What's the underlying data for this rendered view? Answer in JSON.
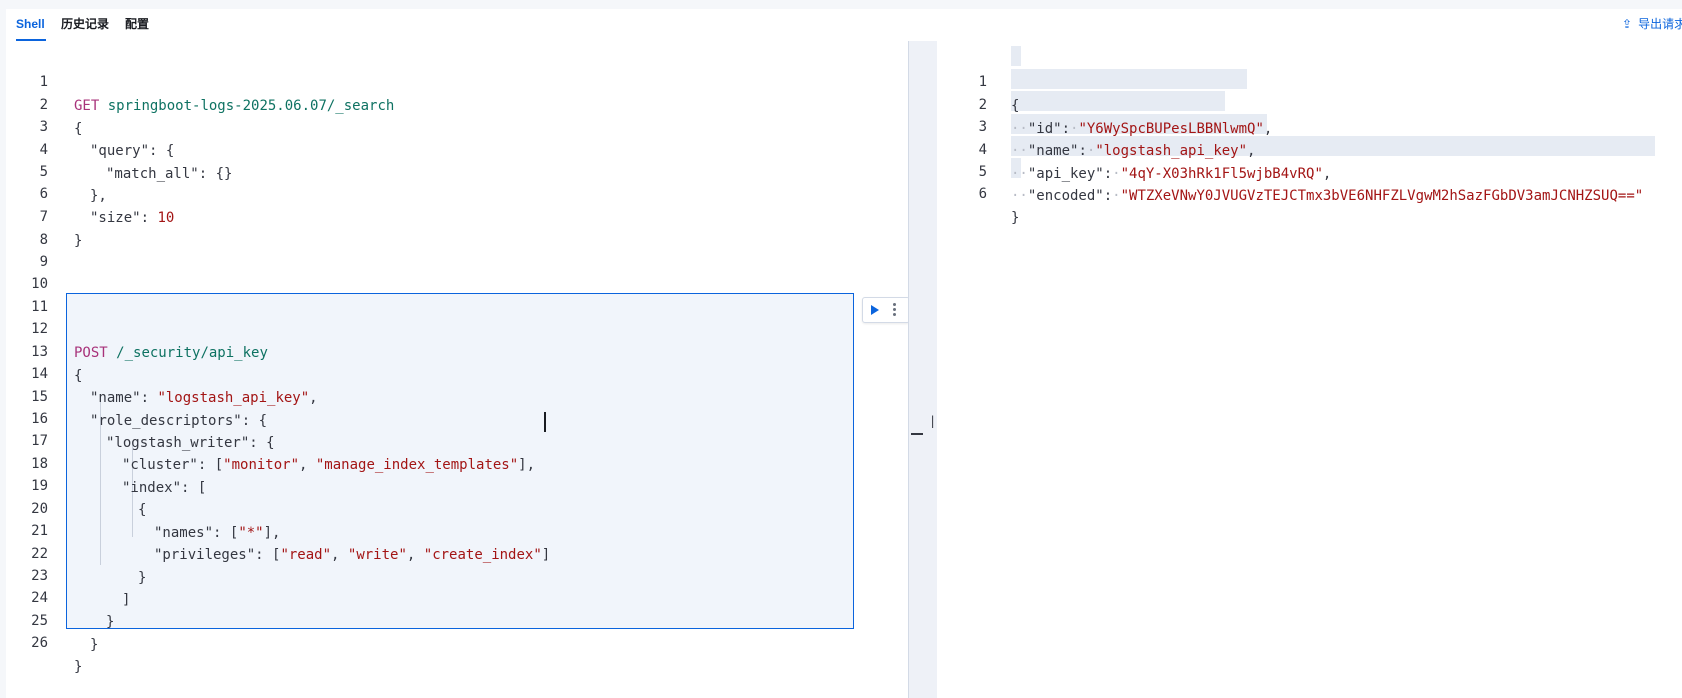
{
  "tabs": [
    {
      "label": "Shell",
      "active": true
    },
    {
      "label": "历史记录",
      "active": false
    },
    {
      "label": "配置",
      "active": false
    }
  ],
  "export_label": "导出请求",
  "icons": {
    "export": "upload-icon",
    "run": "play-icon",
    "more": "kebab-menu-icon",
    "divider": "resize-handle-icon"
  },
  "colors": {
    "accent": "#0b64dd",
    "method": "#a8327a",
    "url": "#0e7262",
    "string": "#a31515"
  },
  "editor": {
    "line_numbers": [
      "1",
      "2",
      "3",
      "4",
      "5",
      "6",
      "7",
      "8",
      "9",
      "10",
      "11",
      "12",
      "13",
      "14",
      "15",
      "16",
      "17",
      "18",
      "19",
      "20",
      "21",
      "22",
      "23",
      "24",
      "25",
      "26"
    ],
    "request1": {
      "method": "GET",
      "path": "springboot-logs-2025.06.07/_search",
      "l2": "{",
      "l3_key": "\"query\"",
      "l3_rest": ": {",
      "l4_key": "\"match_all\"",
      "l4_rest": ": {}",
      "l5": "},",
      "l6_key": "\"size\"",
      "l6_sep": ": ",
      "l6_val": "10",
      "l7": "}"
    },
    "request2": {
      "method": "POST",
      "path": "/_security/api_key",
      "l13": "{",
      "l14_key": "\"name\"",
      "l14_sep": ": ",
      "l14_val": "\"logstash_api_key\"",
      "l14_end": ",",
      "l15_key": "\"role_descriptors\"",
      "l15_rest": ": {",
      "l16_key": "\"logstash_writer\"",
      "l16_rest": ": {",
      "l17_key": "\"cluster\"",
      "l17_sep": ": [",
      "l17_v1": "\"monitor\"",
      "l17_comma": ", ",
      "l17_v2": "\"manage_index_templates\"",
      "l17_end": "],",
      "l18_key": "\"index\"",
      "l18_rest": ": [",
      "l19": "{",
      "l20_key": "\"names\"",
      "l20_sep": ": [",
      "l20_v1": "\"*\"",
      "l20_end": "],",
      "l21_key": "\"privileges\"",
      "l21_sep": ": [",
      "l21_v1": "\"read\"",
      "l21_c1": ", ",
      "l21_v2": "\"write\"",
      "l21_c2": ", ",
      "l21_v3": "\"create_index\"",
      "l21_end": "]",
      "l22": "}",
      "l23": "]",
      "l24": "}",
      "l25": "}",
      "l26": "}"
    }
  },
  "output": {
    "line_numbers": [
      "1",
      "2",
      "3",
      "4",
      "5",
      "6"
    ],
    "l1": "{",
    "id_key": "\"id\"",
    "id_val": "\"Y6WySpcBUPesLBBNlwmQ\"",
    "name_key": "\"name\"",
    "name_val": "\"logstash_api_key\"",
    "api_key_key": "\"api_key\"",
    "api_key_val": "\"4qY-X03hRk1Fl5wjbB4vRQ\"",
    "encoded_key": "\"encoded\"",
    "encoded_val": "\"WTZXeVNwY0JVUGVzTEJCTmx3bVE6NHFZLVgwM2hSazFGbDV3amJCNHZSUQ==\"",
    "l6": "}",
    "sep": ":",
    "comma": ",",
    "ws_dots": "··",
    "ws_dot": "·"
  }
}
